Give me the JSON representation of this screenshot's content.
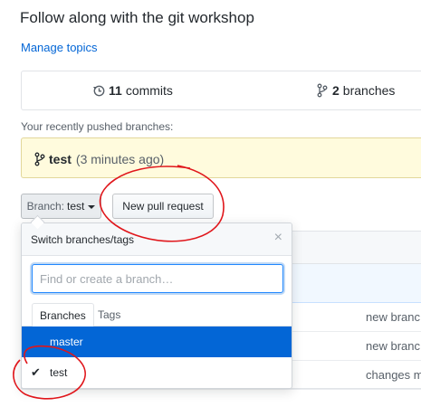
{
  "repo": {
    "description": "Follow along with the git workshop",
    "manage_topics": "Manage topics"
  },
  "stats": {
    "commits_count": "11",
    "commits_label": "commits",
    "branches_count": "2",
    "branches_label": "branches"
  },
  "recent": {
    "label": "Your recently pushed branches:",
    "branch": "test",
    "time": "(3 minutes ago)"
  },
  "toolbar": {
    "branch_prefix": "Branch:",
    "branch_value": "test",
    "new_pr_label": "New pull request"
  },
  "dropdown": {
    "title": "Switch branches/tags",
    "close_glyph": "×",
    "filter_placeholder": "Find or create a branch…",
    "tabs": [
      {
        "label": "Branches",
        "active": true
      },
      {
        "label": "Tags",
        "active": false
      }
    ],
    "items": [
      {
        "label": "master",
        "highlighted": true,
        "checked": false
      },
      {
        "label": "test",
        "highlighted": false,
        "checked": true
      }
    ],
    "check_glyph": "✔"
  },
  "background_rows": [
    {
      "text": "new branc"
    },
    {
      "text": "new branc"
    },
    {
      "text": "changes m"
    }
  ],
  "colors": {
    "link": "#0366d6",
    "highlight": "#0366d6",
    "annotation": "#e0161b",
    "pushed_bg": "#fffbdd"
  },
  "icons": {
    "commits": "history-icon",
    "branches": "git-branch-icon",
    "close": "x-icon",
    "check": "check-icon"
  }
}
